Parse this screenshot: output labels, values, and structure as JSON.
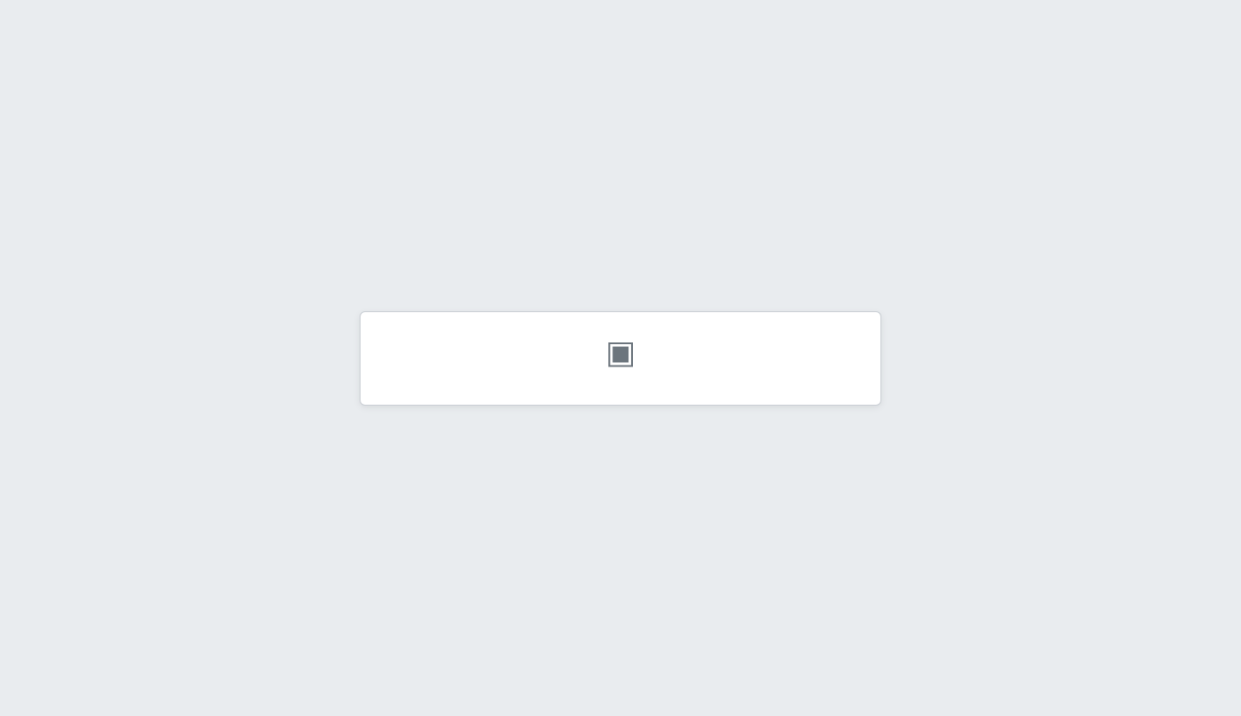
{
  "notice": {
    "icon": "image-missing-icon",
    "title": "",
    "message": ""
  }
}
